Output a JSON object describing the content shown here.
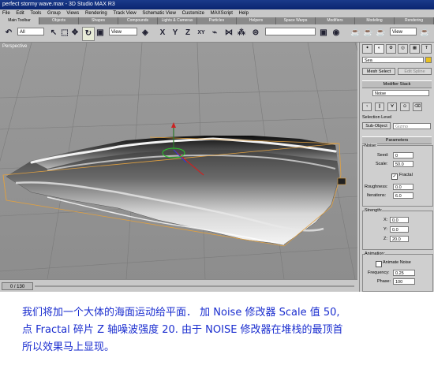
{
  "window": {
    "title": "perfect stormy wave.max - 3D Studio MAX R3"
  },
  "menu": [
    "File",
    "Edit",
    "Tools",
    "Group",
    "Views",
    "Rendering",
    "Track View",
    "Schematic View",
    "Customize",
    "MAXScript",
    "Help"
  ],
  "tabs": [
    "Main Toolbar",
    "Objects",
    "Shapes",
    "Compounds",
    "Lights & Cameras",
    "Particles",
    "Helpers",
    "Space Warps",
    "Modifiers",
    "Modeling",
    "Rendering"
  ],
  "toolbar": {
    "selection_filter": "All",
    "ref_coord": "View",
    "axis_labels": [
      "X",
      "Y",
      "Z",
      "XY"
    ],
    "named_sel": "",
    "view2": "View"
  },
  "viewport": {
    "label": "Perspective"
  },
  "panel": {
    "object_name": "Sea",
    "mesh_select": "Mesh Select",
    "edit_spline": "Edit Spline",
    "modifier_stack": "Modifier Stack",
    "stack_value": "Noise",
    "selection_level": "Selection Level",
    "sub_object": "Sub-Object",
    "gizmo": "Gizmo",
    "parameters": "Parameters",
    "noise_label": "Noise:",
    "seed_label": "Seed:",
    "seed": "0",
    "scale_label": "Scale:",
    "scale": "50.0",
    "fractal": "Fractal",
    "roughness_label": "Roughness:",
    "roughness": "0.0",
    "iterations_label": "Iterations:",
    "iterations": "6.0",
    "strength_label": "Strength:",
    "x_label": "X:",
    "x": "0.0",
    "y_label": "Y:",
    "y": "0.0",
    "z_label": "Z:",
    "z": "20.0",
    "animation_label": "Animation:",
    "animate_noise": "Animate Noise",
    "frequency_label": "Frequency:",
    "frequency": "0.25",
    "phase_label": "Phase:",
    "phase": "100"
  },
  "status": {
    "frame": "0 / 130"
  },
  "caption": {
    "line1": "我们将加一个大体的海面运动给平面． 加 Noise 修改器  Scale 值 50,",
    "line2": "点 Fractal 碎片 Z 轴噪波强度 20. 由于 NOISE 修改器在堆栈的最顶首",
    "line3": "所以效果马上显现。"
  },
  "colors": {
    "caption": "#1a2dcf",
    "title_bar": "#0a2570",
    "viewport": "#9a9a9a",
    "panel": "#cfcfcf"
  }
}
